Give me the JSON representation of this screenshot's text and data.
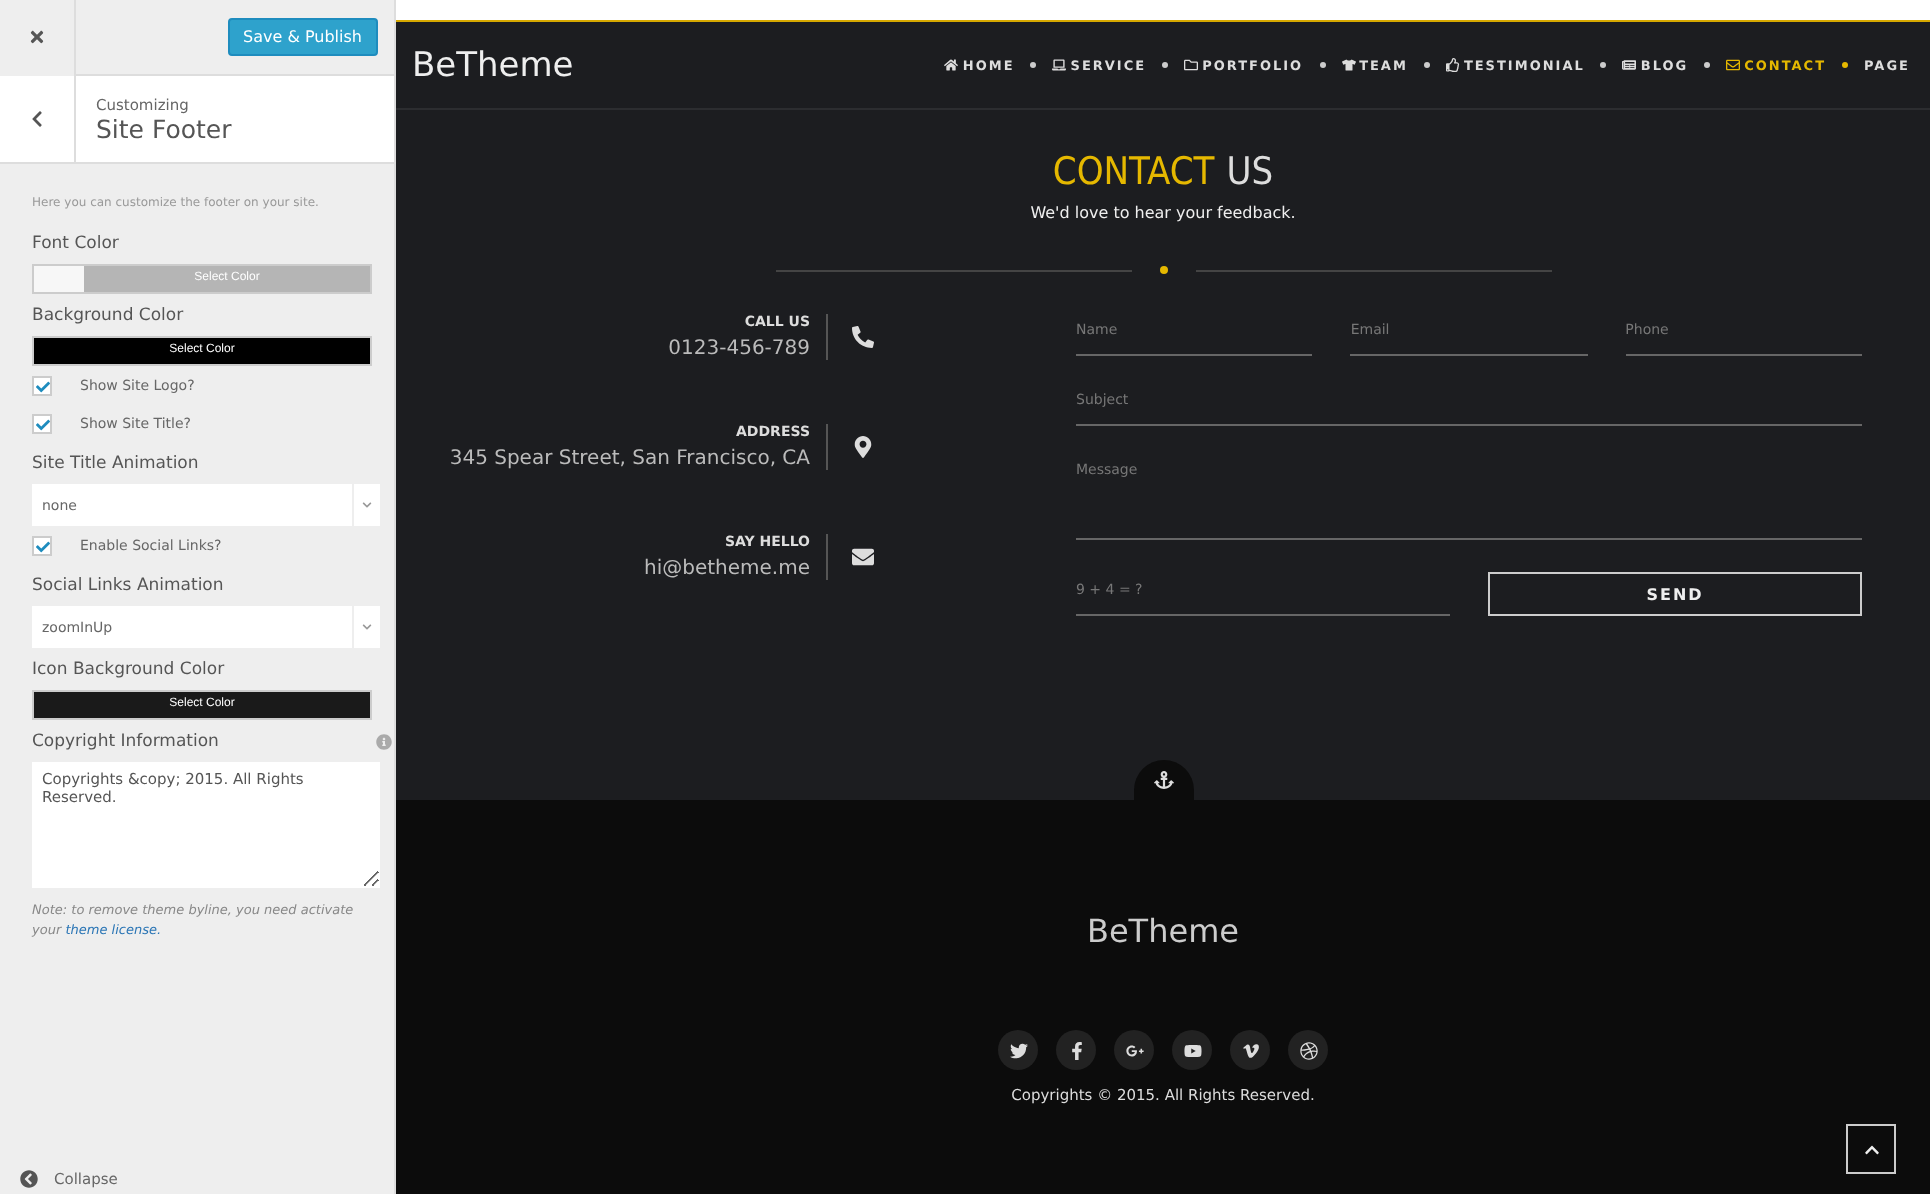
{
  "customizer": {
    "save_button": "Save & Publish",
    "breadcrumb": "Customizing",
    "section_title": "Site Footer",
    "description": "Here you can customize the footer on your site.",
    "controls": [
      {
        "kind": "color",
        "label": "Font Color",
        "button": "Select Color",
        "color": "#f7f7f7"
      },
      {
        "kind": "color",
        "label": "Background Color",
        "button": "Select Color",
        "color": "#000000"
      },
      {
        "kind": "checkbox",
        "label": "Show Site Logo?",
        "checked": true
      },
      {
        "kind": "checkbox",
        "label": "Show Site Title?",
        "checked": true
      },
      {
        "kind": "select",
        "label": "Site Title Animation",
        "value": "none"
      },
      {
        "kind": "checkbox",
        "label": "Enable Social Links?",
        "checked": true
      },
      {
        "kind": "select",
        "label": "Social Links Animation",
        "value": "zoomInUp"
      },
      {
        "kind": "color",
        "label": "Icon Background Color",
        "button": "Select Color",
        "color": "#1a1a1a"
      },
      {
        "kind": "textarea",
        "label": "Copyright Information",
        "value": "Copyrights &copy; 2015. All Rights Reserved."
      }
    ],
    "note": "Note: to remove theme byline, you need activate your",
    "note_link": "theme license.",
    "collapse": "Collapse"
  },
  "site": {
    "logo": "BeTheme",
    "nav": [
      {
        "label": "HOME",
        "selected": false
      },
      {
        "label": "SERVICE",
        "selected": false
      },
      {
        "label": "PORTFOLIO",
        "selected": false
      },
      {
        "label": "TEAM",
        "selected": false
      },
      {
        "label": "TESTIMONIAL",
        "selected": false
      },
      {
        "label": "BLOG",
        "selected": false
      },
      {
        "label": "CONTACT",
        "selected": true
      },
      {
        "label": "PAGE",
        "selected": false
      }
    ],
    "heading_accent": "CONTACT",
    "heading_rest": "US",
    "subtitle": "We'd love to hear your feedback.",
    "contacts": [
      {
        "title": "CALL US",
        "value": "0123-456-789",
        "kind": "phone"
      },
      {
        "title": "ADDRESS",
        "value": "345 Spear Street, San Francisco, CA",
        "kind": "location"
      },
      {
        "title": "SAY HELLO",
        "value": "hi@betheme.me",
        "kind": "mail"
      }
    ],
    "form": {
      "fields": [
        {
          "placeholder": "Name"
        },
        {
          "placeholder": "Email"
        },
        {
          "placeholder": "Phone"
        },
        {
          "placeholder": "Subject"
        },
        {
          "placeholder": "Message"
        },
        {
          "placeholder": "9 + 4 = ?"
        }
      ],
      "send": "SEND"
    },
    "footer": {
      "logo": "BeTheme",
      "social": [
        {
          "kind": "twitter"
        },
        {
          "kind": "facebook"
        },
        {
          "kind": "googleplus"
        },
        {
          "kind": "youtube"
        },
        {
          "kind": "vimeo"
        },
        {
          "kind": "dribbble"
        }
      ],
      "copyright": "Copyrights © 2015. All Rights Reserved."
    }
  }
}
